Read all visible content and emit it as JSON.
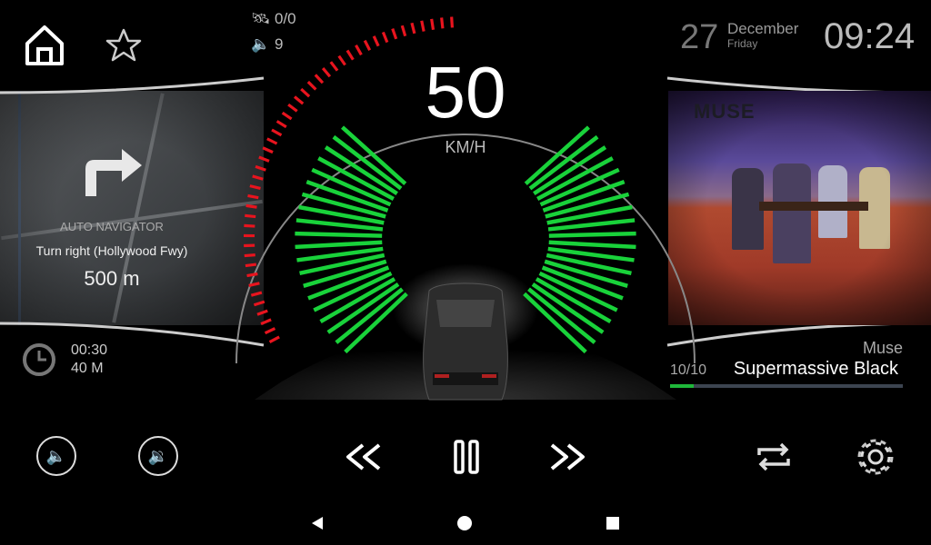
{
  "status": {
    "satellites": "0/0",
    "volume": "9"
  },
  "date": {
    "day": "27",
    "month": "December",
    "weekday": "Friday"
  },
  "clock": "09:24",
  "speed": {
    "value": "50",
    "unit": "KM/H"
  },
  "navigation": {
    "title": "AUTO NAVIGATOR",
    "instruction": "Turn right (Hollywood Fwy)",
    "distance": "500 m",
    "eta_time": "00:30",
    "eta_distance": "40 M"
  },
  "music": {
    "artist": "Muse",
    "title": "Supermassive Black",
    "track": "10/10",
    "progress_percent": 10,
    "album_logo": "MUSE"
  },
  "colors": {
    "accent_green": "#19d23a",
    "speed_red": "#e8141e",
    "progress_green": "#1fb83a"
  },
  "controls": [
    "volume-down",
    "volume-up",
    "rewind",
    "pause",
    "fast-forward",
    "repeat",
    "settings"
  ],
  "system_nav": [
    "back",
    "home",
    "recents"
  ]
}
